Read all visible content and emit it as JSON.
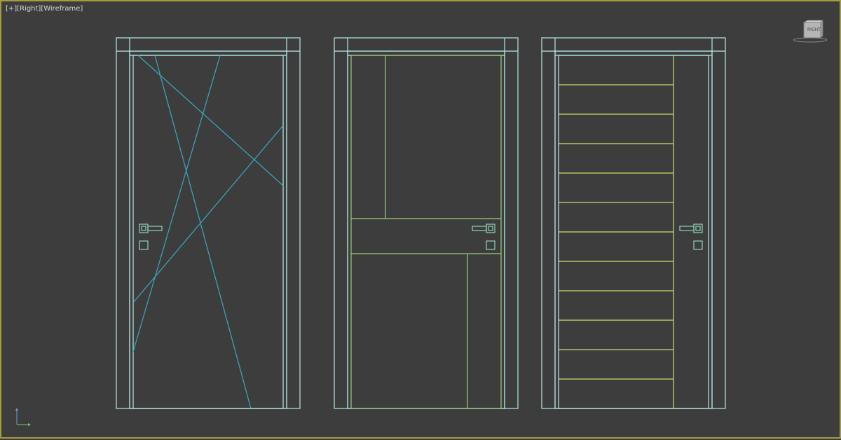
{
  "viewport": {
    "menu_label": "[+]",
    "view_label": "[Right]",
    "shading_label": "[Wireframe]",
    "border_color": "#a89a3e",
    "background_color": "#3d3d3d"
  },
  "viewcube": {
    "face_label": "RIGHT"
  },
  "colors": {
    "frame_outline": "#b9e8e8",
    "door1_lines": "#3ba8c0",
    "door2_panels": "#9bd07a",
    "door3_slats": "#c6e36a",
    "hardware": "#8fd6b6",
    "axis_x": "#7cc86a",
    "axis_y": "#6aa0d8"
  },
  "objects": [
    {
      "name": "Door 1 - diagonal line pattern"
    },
    {
      "name": "Door 2 - asymmetric panel pattern"
    },
    {
      "name": "Door 3 - horizontal slat pattern"
    }
  ]
}
